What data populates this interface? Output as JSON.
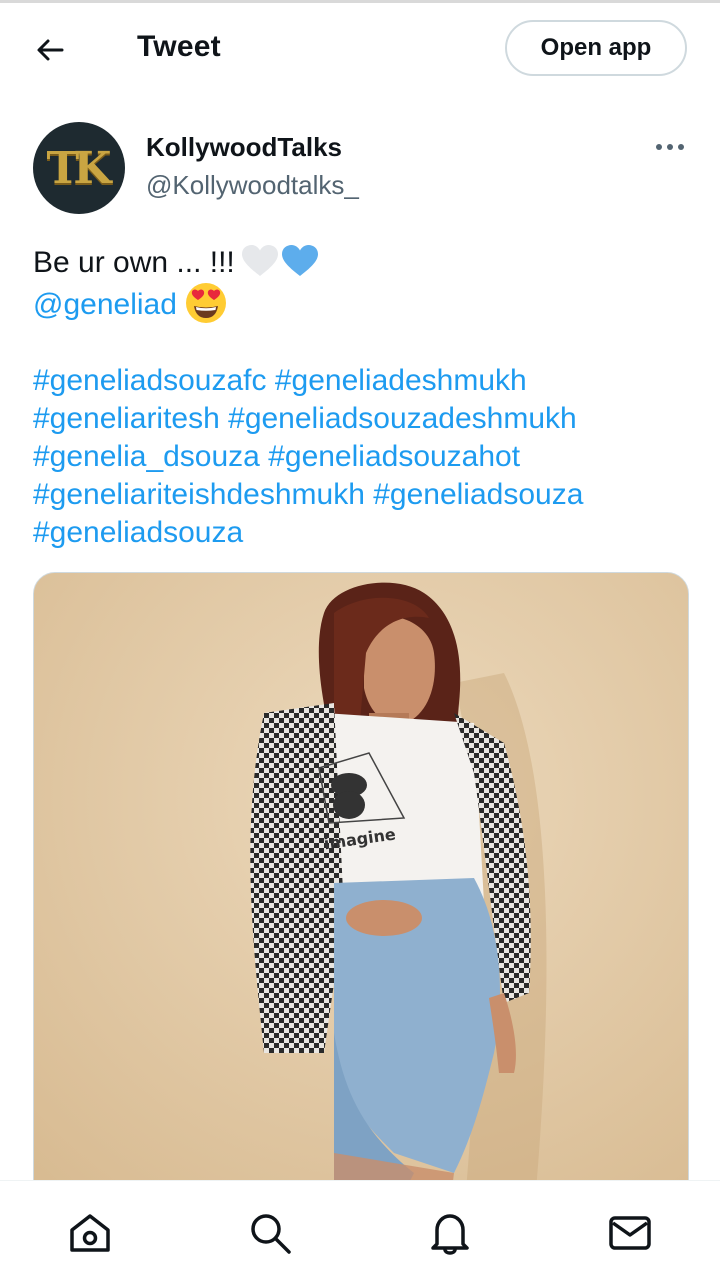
{
  "header": {
    "title": "Tweet",
    "open_app_label": "Open app"
  },
  "author": {
    "avatar_initials": "TK",
    "display_name": "KollywoodTalks",
    "handle": "@Kollywoodtalks_"
  },
  "tweet": {
    "text_line1": "Be ur own ... !!!",
    "mention": "@geneliad",
    "hashtag_lines": [
      "#geneliadsouzafc #geneliadeshmukh",
      "#geneliaritesh #geneliadsouzadeshmukh",
      "#genelia_dsouza #geneliadsouzahot",
      "#geneliariteishdeshmukh #geneliadsouza",
      "#geneliadsouza"
    ],
    "media_tshirt_text": "imagine"
  },
  "bottom_nav": {
    "items": [
      "home-icon",
      "search-icon",
      "notifications-icon",
      "messages-icon"
    ]
  },
  "colors": {
    "accent": "#1d9bf0",
    "text": "#0f1419",
    "secondary": "#536471",
    "border": "#cfd9de"
  }
}
